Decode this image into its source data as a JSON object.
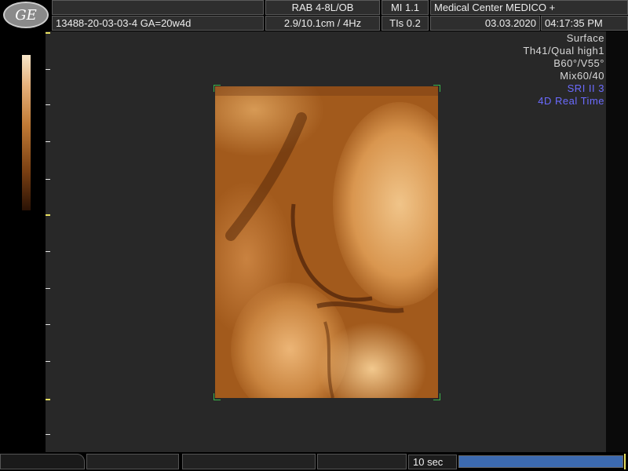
{
  "header": {
    "logo_text": "GE",
    "probe_preset": "RAB 4-8L/OB",
    "mi": "MI  1.1",
    "institution": "Medical Center MEDICO +",
    "patient_id": "13488-20-03-03-4  GA=20w4d",
    "depth_freq": "2.9/10.1cm /  4Hz",
    "tis": "TIs  0.2",
    "date": "03.03.2020",
    "time": "04:17:35 PM"
  },
  "render_info": {
    "mode": "Surface",
    "threshold_quality": "Th41/Qual high1",
    "angles": "B60°/V55°",
    "mix": "Mix60/40",
    "sri": "SRI II 3",
    "realtime": "4D Real Time"
  },
  "status_bar": {
    "timer_label": "10 sec",
    "progress": 1.0
  },
  "colors": {
    "accent_blue": "#6b6bff",
    "sepia_mid": "#c17a35",
    "progress_blue": "#3c6ab0",
    "corner_green": "#3ab34a"
  },
  "icons": [
    "ge-logo-icon",
    "trackball-icon"
  ]
}
